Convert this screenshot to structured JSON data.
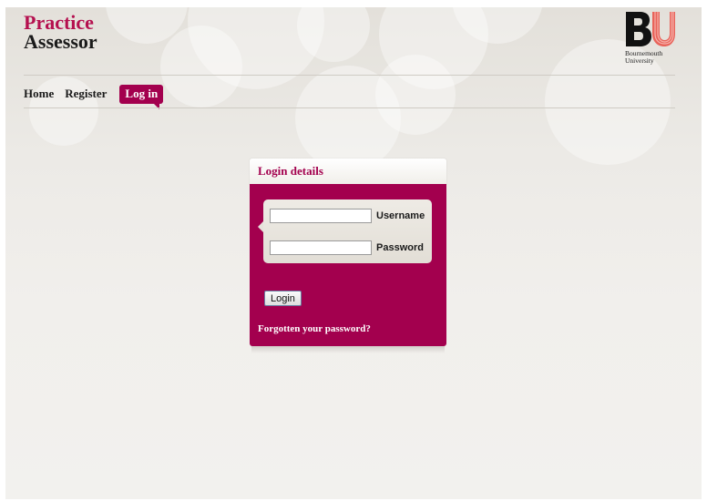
{
  "header": {
    "title_line1": "Practice",
    "title_line2": "Assessor",
    "logo_letters": "BU",
    "logo_text_line1": "Bournemouth",
    "logo_text_line2": "University"
  },
  "nav": {
    "items": [
      {
        "label": "Home",
        "active": false
      },
      {
        "label": "Register",
        "active": false
      },
      {
        "label": "Log in",
        "active": true
      }
    ]
  },
  "login": {
    "heading": "Login details",
    "username_label": "Username",
    "username_value": "",
    "password_label": "Password",
    "password_value": "",
    "submit_label": "Login",
    "forgot_link": "Forgotten your password?"
  },
  "colors": {
    "brand": "#a3004e",
    "logo_u": "#e8635a"
  }
}
